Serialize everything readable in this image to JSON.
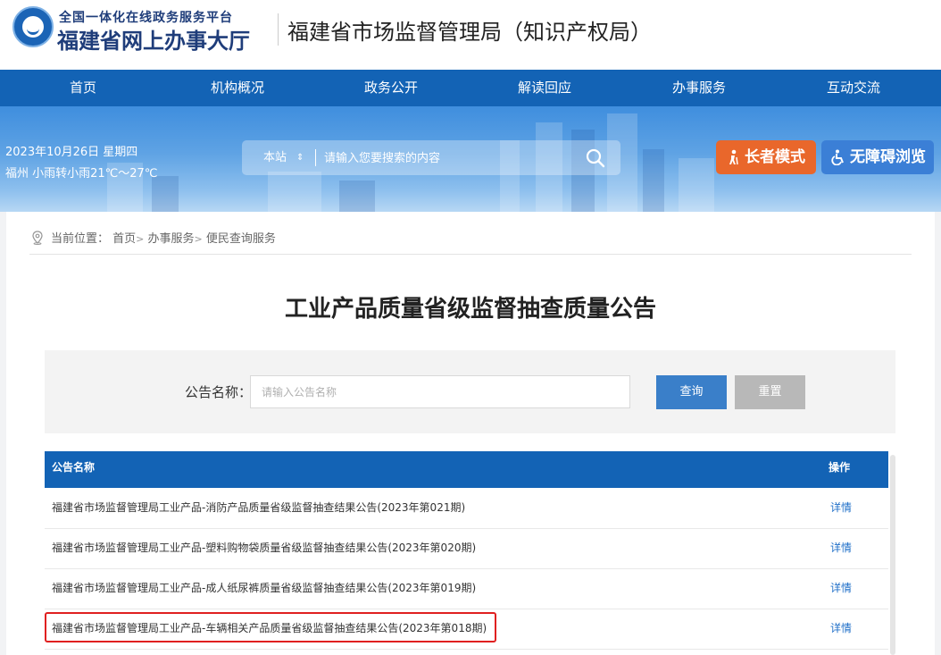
{
  "header": {
    "logo_subtitle": "全国一体化在线政务服务平台",
    "logo_title": "福建省网上办事大厅",
    "org_name": "福建省市场监督管理局（知识产权局）"
  },
  "nav": {
    "items": [
      {
        "label": "首页"
      },
      {
        "label": "机构概况"
      },
      {
        "label": "政务公开"
      },
      {
        "label": "解读回应"
      },
      {
        "label": "办事服务"
      },
      {
        "label": "互动交流"
      }
    ]
  },
  "banner": {
    "date": "2023年10月26日 星期四",
    "weather": "福州 小雨转小雨21℃～27℃",
    "search": {
      "scope": "本站",
      "placeholder": "请输入您要搜索的内容"
    },
    "elder_mode_label": "长者模式",
    "accessible_label": "无障碍浏览"
  },
  "breadcrumb": {
    "prefix": "当前位置：",
    "items": [
      "首页",
      "办事服务",
      "便民查询服务"
    ],
    "separator": ">"
  },
  "page": {
    "title": "工业产品质量省级监督抽查质量公告"
  },
  "filter": {
    "label": "公告名称：",
    "placeholder": "请输入公告名称",
    "query_label": "查询",
    "reset_label": "重置"
  },
  "table": {
    "headers": {
      "name": "公告名称",
      "action": "操作"
    },
    "rows": [
      {
        "name": "福建省市场监督管理局工业产品-消防产品质量省级监督抽查结果公告(2023年第021期)",
        "action": "详情"
      },
      {
        "name": "福建省市场监督管理局工业产品-塑料购物袋质量省级监督抽查结果公告(2023年第020期)",
        "action": "详情"
      },
      {
        "name": "福建省市场监督管理局工业产品-成人纸尿裤质量省级监督抽查结果公告(2023年第019期)",
        "action": "详情"
      },
      {
        "name": "福建省市场监督管理局工业产品-车辆相关产品质量省级监督抽查结果公告(2023年第018期)",
        "action": "详情",
        "highlighted": true
      }
    ]
  },
  "colors": {
    "primary_blue": "#1363b5",
    "elder_orange": "#e9672b",
    "highlight_red": "#e02020",
    "link_blue": "#1f6fc8"
  }
}
